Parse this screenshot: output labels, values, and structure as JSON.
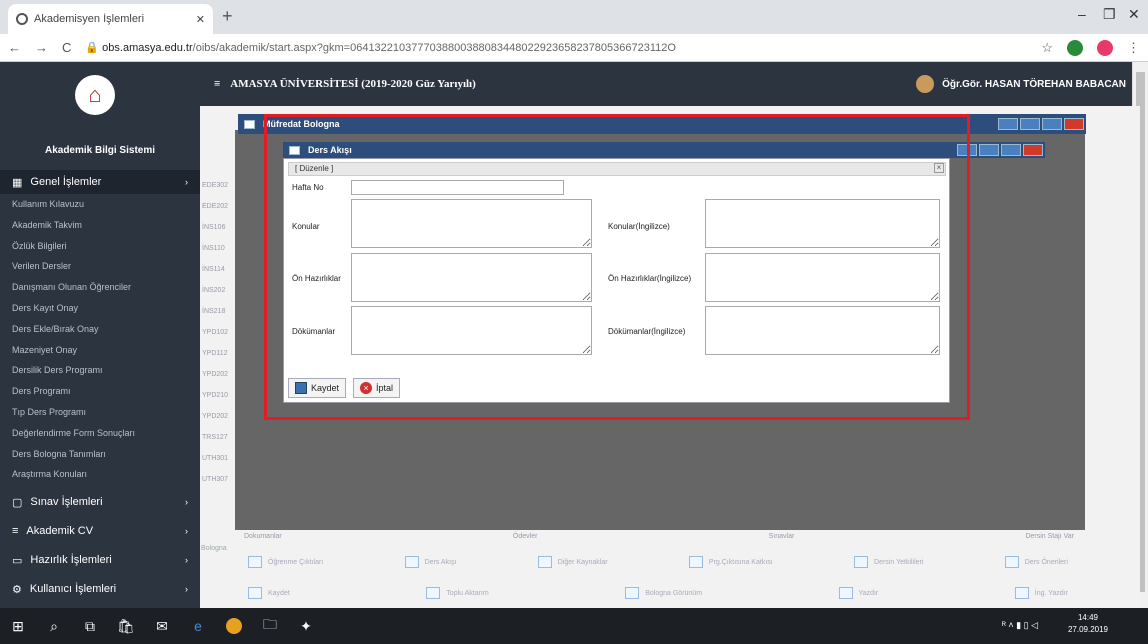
{
  "browser": {
    "tab_title": "Akademisyen İşlemleri",
    "url_host": "obs.amasya.edu.tr",
    "url_path": "/oibs/akademik/start.aspx?gkm=0641322103777038800388083448022923658237805366723112O"
  },
  "sidebar": {
    "system_name": "Akademik Bilgi Sistemi",
    "genel_label": "Genel İşlemler",
    "items": [
      "Kullanım Kılavuzu",
      "Akademik Takvim",
      "Özlük Bilgileri",
      "Verilen Dersler",
      "Danışmanı Olunan Öğrenciler",
      "Ders Kayıt Onay",
      "Ders Ekle/Bırak Onay",
      "Mazeniyet Onay",
      "Dersilik Ders Programı",
      "Ders Programı",
      "Tıp Ders Programı",
      "Değerlendirme Form Sonuçları",
      "Ders Bologna Tanımları",
      "Araştırma Konuları"
    ],
    "sections": [
      "Sınav İşlemleri",
      "Akademik CV",
      "Hazırlık İşlemleri",
      "Kullanıcı İşlemleri"
    ]
  },
  "header": {
    "title": "AMASYA ÜNİVERSİTESİ (2019-2020 Güz Yarıyılı)",
    "user": "Öğr.Gör. HASAN TÖREHAN BABACAN"
  },
  "bg": {
    "codes": [
      "EDE302",
      "EDE202",
      "İNS106",
      "İNS110",
      "İNS114",
      "İNS202",
      "İNS218",
      "YPD102",
      "YPD112",
      "YPD202",
      "YPD210",
      "YPD202",
      "TRS127",
      "UTH301",
      "UTH307"
    ],
    "toolbar1": [
      "Öğrenme Çıktıları",
      "Ders Akışı",
      "Diğer Kaynaklar",
      "Prg.Çıktısına Katkısı",
      "Dersin Yetkilileri",
      "Ders Önerileri"
    ],
    "toolbar2": [
      "Kaydet",
      "Toplu Aktarım",
      "Bologna Görünüm",
      "Yazdır",
      "İng. Yazdır"
    ],
    "bottom_labels": [
      "Dokumanlar",
      "Ödevler",
      "Sınavlar",
      "Dersin Stajı Var"
    ],
    "bologna": "Bologna"
  },
  "window_mufredat": {
    "title": "Müfredat Bologna"
  },
  "dialog": {
    "title": "Ders Akışı",
    "section": "[ Düzenle ]",
    "hafta_no": "Hafta No",
    "konular": "Konular",
    "konular_en": "Konular(İngilizce)",
    "on_hazirliklar": "Ön Hazırlıklar",
    "on_hazirliklar_en": "Ön Hazırlıklar(İngilizce)",
    "dokumanlar": "Dökümanlar",
    "dokumanlar_en": "Dökümanlar(İngilizce)",
    "save": "Kaydet",
    "cancel": "İptal"
  },
  "taskbar": {
    "time": "14:49",
    "date": "27.09.2019"
  }
}
